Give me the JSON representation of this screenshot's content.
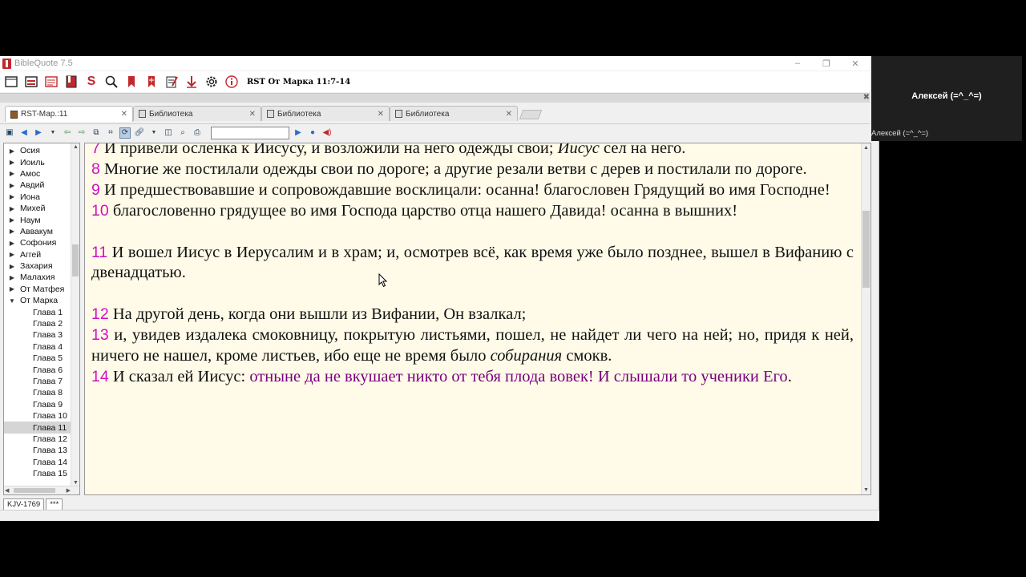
{
  "window": {
    "title": "BibleQuote 7.5",
    "controls": {
      "minimize": "–",
      "maximize": "❐",
      "close": "✕"
    }
  },
  "toolbar": {
    "icons": [
      "window-icon",
      "library-icon",
      "notes-icon",
      "bookmark-book-icon",
      "strong-icon",
      "search-icon",
      "bookmark-icon",
      "bookmark-add-icon",
      "memo-icon",
      "download-icon",
      "settings-icon",
      "info-icon"
    ],
    "strong_label": "S",
    "caption": "RST От Марка 11:7-14"
  },
  "tabs": [
    {
      "label": "RST-Мар.:11",
      "active": true
    },
    {
      "label": "Библиотека",
      "active": false
    },
    {
      "label": "Библиотека",
      "active": false
    },
    {
      "label": "Библиотека",
      "active": false
    }
  ],
  "tab_close": "✕",
  "sidebar": {
    "books": [
      "Осия",
      "Иоиль",
      "Амос",
      "Авдий",
      "Иона",
      "Михей",
      "Наум",
      "Аввакум",
      "Софония",
      "Аггей",
      "Захария",
      "Малахия",
      "От Матфея"
    ],
    "expanded_book": "От Марка",
    "chapters": [
      "Глава 1",
      "Глава 2",
      "Глава 3",
      "Глава 4",
      "Глава 5",
      "Глава 6",
      "Глава 7",
      "Глава 8",
      "Глава 9",
      "Глава 10",
      "Глава 11",
      "Глава 12",
      "Глава 13",
      "Глава 14",
      "Глава 15"
    ],
    "selected_chapter": "Глава 11",
    "collapsed_arrow": "▶",
    "expanded_arrow": "▼"
  },
  "verses": [
    {
      "num": "7",
      "segments": [
        {
          "t": " И привели осленка к Иисусу, и возложили на него одежды свои; "
        },
        {
          "t": "Иисус",
          "i": true
        },
        {
          "t": " сел на него."
        }
      ]
    },
    {
      "num": "8",
      "segments": [
        {
          "t": " Многие же постилали одежды свои по дороге; а другие резали ветви с дерев и постилали по дороге."
        }
      ]
    },
    {
      "num": "9",
      "segments": [
        {
          "t": " И предшествовавшие и сопровождавшие восклицали: осанна! благословен Грядущий во имя Господне!"
        }
      ]
    },
    {
      "num": "10",
      "segments": [
        {
          "t": " благословенно грядущее во имя Господа царство отца нашего Давида! осанна в вышних!"
        }
      ],
      "gap_after": true
    },
    {
      "num": "11",
      "segments": [
        {
          "t": " И вошел Иисус в Иерусалим и в храм; и, осмотрев всё, как время уже было позднее, вышел в Вифанию с двенадцатью."
        }
      ],
      "gap_after": true
    },
    {
      "num": "12",
      "segments": [
        {
          "t": " На другой день, когда они вышли из Вифании, Он взалкал;"
        }
      ]
    },
    {
      "num": "13",
      "segments": [
        {
          "t": " и, увидев издалека смоковницу, покрытую листьями, пошел, не найдет ли чего на ней; но, придя к ней, ничего не нашел, кроме листьев, ибо еще не время было "
        },
        {
          "t": "собирания",
          "i": true
        },
        {
          "t": " смокв."
        }
      ]
    },
    {
      "num": "14",
      "segments": [
        {
          "t": " И сказал ей Иисус: "
        },
        {
          "t": "отныне да не вкушает никто от тебя плода вовек!",
          "w": true
        },
        {
          "t": " "
        },
        {
          "t": "И слышали то ученики Его",
          "w": true
        },
        {
          "t": "."
        }
      ]
    }
  ],
  "bottom_tabs": [
    "KJV-1769",
    "***"
  ],
  "participant": {
    "name": "Алексей (=^_^=)",
    "label": "Алексей (=^_^=)"
  },
  "colors": {
    "verse_number": "#d010c0",
    "words_of_christ": "#7a0080",
    "text_background": "#fffbe8"
  }
}
